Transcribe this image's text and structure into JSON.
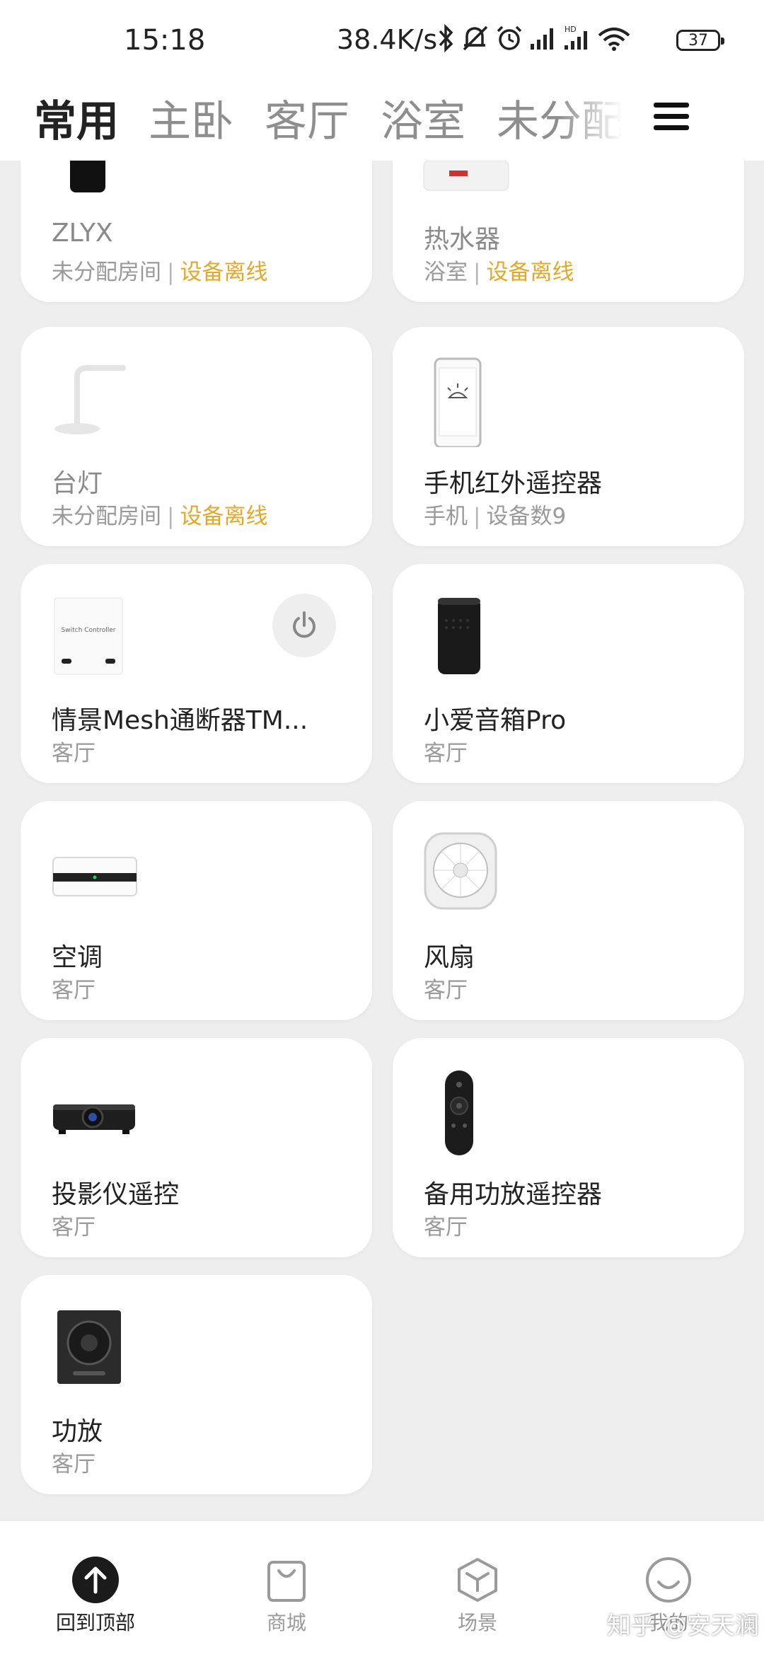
{
  "status_bar": {
    "time": "15:18",
    "net_speed": "38.4K/s",
    "battery": "37",
    "icons": [
      "bluetooth-icon",
      "mute-icon",
      "alarm-icon",
      "signal-icon",
      "signal-hd-icon",
      "wifi-icon"
    ]
  },
  "tabs": [
    {
      "label": "常用",
      "active": true
    },
    {
      "label": "主卧",
      "active": false
    },
    {
      "label": "客厅",
      "active": false
    },
    {
      "label": "浴室",
      "active": false
    },
    {
      "label": "未分配",
      "active": false
    }
  ],
  "devices": [
    {
      "name": "ZLYX",
      "room": "未分配房间",
      "status": "设备离线",
      "icon": "router-icon",
      "offline": true
    },
    {
      "name": "热水器",
      "room": "浴室",
      "status": "设备离线",
      "icon": "water-heater-icon",
      "offline": true
    },
    {
      "name": "台灯",
      "room": "未分配房间",
      "status": "设备离线",
      "icon": "desk-lamp-icon",
      "offline": true
    },
    {
      "name": "手机红外遥控器",
      "room": "手机",
      "status": "设备数9",
      "icon": "phone-remote-icon",
      "offline": false
    },
    {
      "name": "情景Mesh通断器TM...",
      "room": "客厅",
      "icon": "switch-controller-icon",
      "icon_text": "Switch Controller",
      "has_power": true
    },
    {
      "name": "小爱音箱Pro",
      "room": "客厅",
      "icon": "speaker-icon"
    },
    {
      "name": "空调",
      "room": "客厅",
      "icon": "air-conditioner-icon"
    },
    {
      "name": "风扇",
      "room": "客厅",
      "icon": "fan-icon"
    },
    {
      "name": "投影仪遥控",
      "room": "客厅",
      "icon": "projector-icon"
    },
    {
      "name": "备用功放遥控器",
      "room": "客厅",
      "icon": "remote-control-icon"
    },
    {
      "name": "功放",
      "room": "客厅",
      "icon": "amplifier-icon"
    }
  ],
  "bottom_nav": [
    {
      "label": "回到顶部",
      "icon": "arrow-up-icon",
      "active": true
    },
    {
      "label": "商城",
      "icon": "shopping-bag-icon",
      "active": false
    },
    {
      "label": "场景",
      "icon": "cube-icon",
      "active": false
    },
    {
      "label": "我的",
      "icon": "smile-icon",
      "active": false
    }
  ],
  "watermark": "知乎 @安天澜",
  "colors": {
    "offline_status": "#e2a92a",
    "background": "#eeeeee",
    "card": "#ffffff"
  }
}
